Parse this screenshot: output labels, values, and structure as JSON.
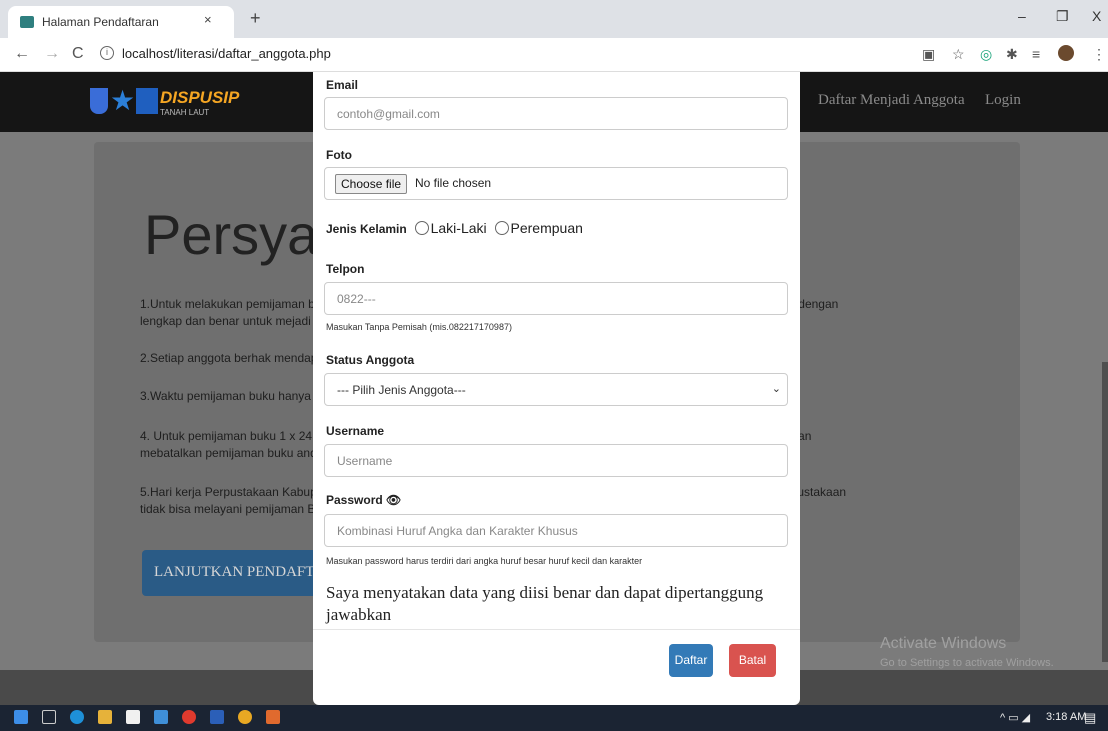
{
  "browser": {
    "tab_title": "Halaman Pendaftaran",
    "tab_close": "×",
    "new_tab": "+",
    "url": "localhost/literasi/daftar_anggota.php",
    "info": "i",
    "window_min": "–",
    "window_max": "❐",
    "window_close": "X"
  },
  "site": {
    "logo_text": "DISPUSIP",
    "logo_sub": "TANAH LAUT",
    "nav_daftar": "Daftar Menjadi Anggota",
    "nav_login": "Login",
    "jumbo_title": "Persyar",
    "paragraphs": [
      "1.Untuk melakukan pemijaman bu                                                                                                       ulir pendaftaran anggota dengan",
      "lengkap dan benar untuk mejadi a",
      "2.Setiap anggota berhak mendapa",
      "3.Waktu pemijaman buku hanya 1",
      "4. Untuk pemijaman buku 1 x 24 j                                                                                                       Kabupaten Tanah Laut akan",
      "mebatalkan pemijaman buku anda",
      "5.Hari kerja Perpustakaan Kabupa                                                                                                      nal / Tanggal Merah Perpustakaan",
      "tidak bisa melayani pemijaman Bu"
    ],
    "continue_button": "LANJUTKAN PENDAFTARAN",
    "activate_title": "Activate Windows",
    "activate_sub": "Go to Settings to activate Windows."
  },
  "form": {
    "email_label": "Email",
    "email_placeholder": "contoh@gmail.com",
    "foto_label": "Foto",
    "file_button": "Choose file",
    "file_status": "No file chosen",
    "gender_label": "Jenis Kelamin",
    "gender_options": [
      "Laki-Laki",
      "Perempuan"
    ],
    "telpon_label": "Telpon",
    "telpon_placeholder": "0822---",
    "telpon_help": "Masukan Tanpa Pemisah (mis.082217170987)",
    "status_label": "Status Anggota",
    "status_selected": "--- Pilih Jenis Anggota---",
    "username_label": "Username",
    "username_placeholder": "Username",
    "password_label": "Password",
    "password_placeholder": "Kombinasi Huruf Angka dan Karakter Khusus",
    "password_help": "Masukan password harus terdiri dari angka huruf besar huruf kecil dan karakter",
    "declaration": "Saya menyatakan data yang diisi benar dan dapat dipertanggung jawabkan",
    "submit": "Daftar",
    "cancel": "Batal"
  },
  "taskbar": {
    "clock": "3:18 AM",
    "tray": "^  ▭  ◢"
  }
}
